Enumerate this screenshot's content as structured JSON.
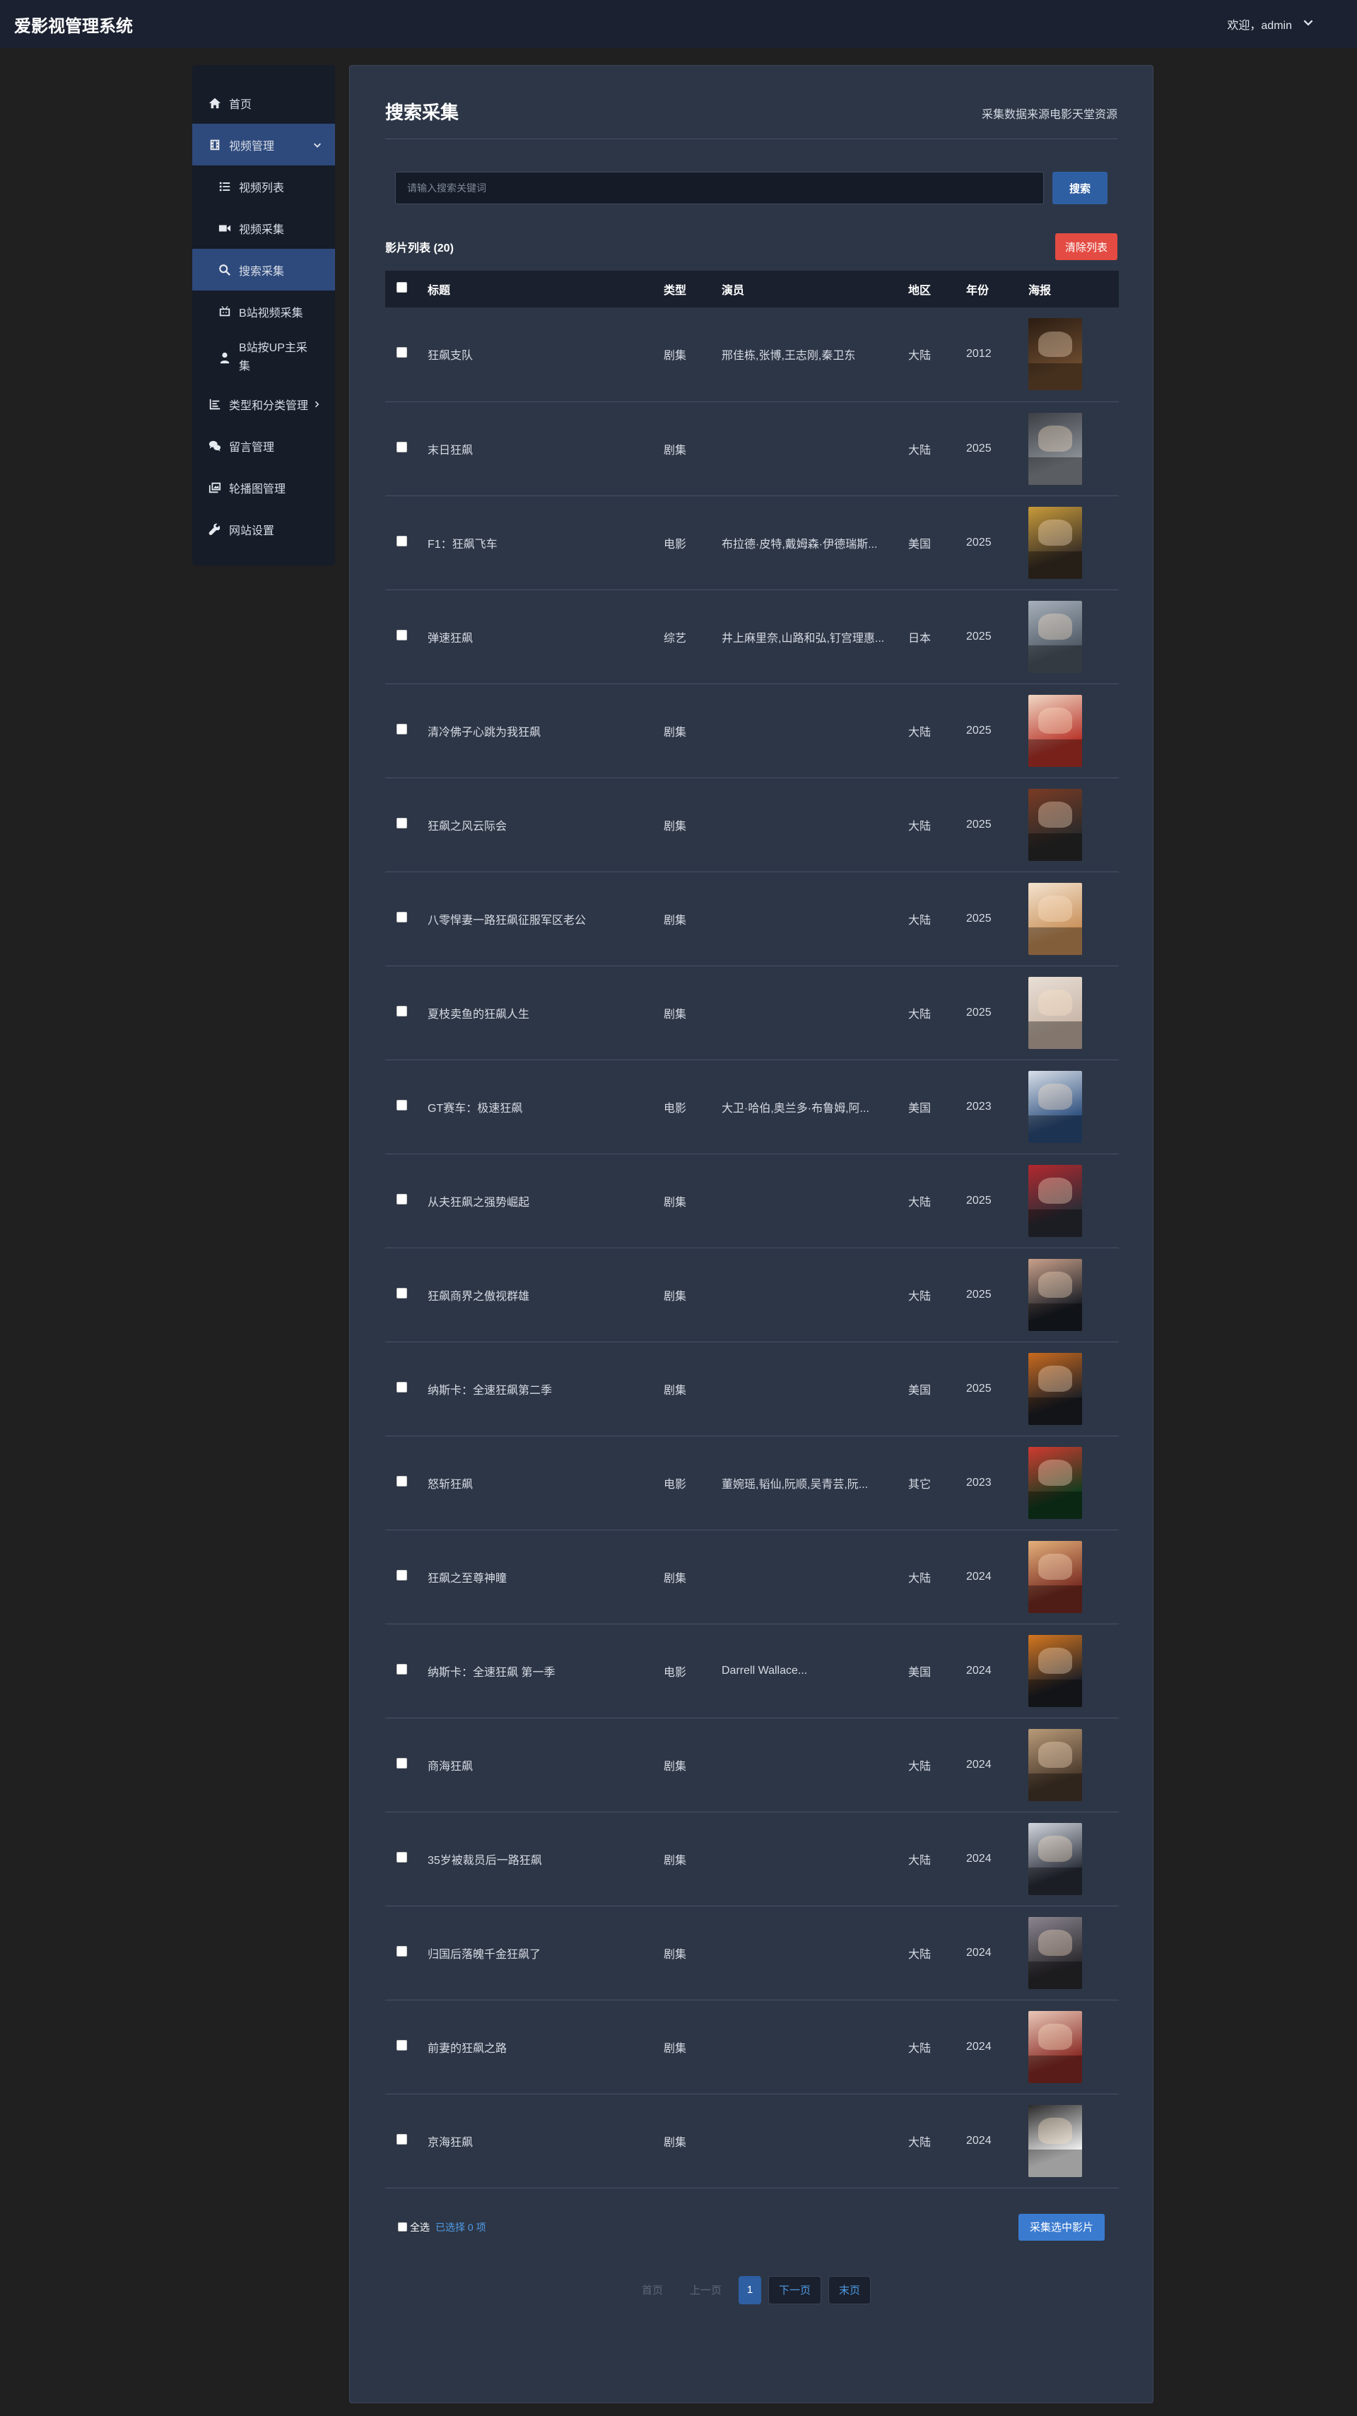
{
  "app": {
    "title": "爱影视管理系统",
    "welcome": "欢迎，admin"
  },
  "sidebar": {
    "items": [
      {
        "label": "首页",
        "icon": "home-icon"
      },
      {
        "label": "视频管理",
        "icon": "film-icon"
      },
      {
        "label": "视频列表",
        "icon": "list-icon"
      },
      {
        "label": "视频采集",
        "icon": "video-camera-icon"
      },
      {
        "label": "搜索采集",
        "icon": "search-icon"
      },
      {
        "label": "B站视频采集",
        "icon": "tv-icon"
      },
      {
        "label": "B站按UP主采集",
        "icon": "user-icon"
      },
      {
        "label": "类型和分类管理",
        "icon": "chart-icon"
      },
      {
        "label": "留言管理",
        "icon": "comments-icon"
      },
      {
        "label": "轮播图管理",
        "icon": "images-icon"
      },
      {
        "label": "网站设置",
        "icon": "wrench-icon"
      }
    ]
  },
  "main": {
    "title": "搜索采集",
    "source_note": "采集数据来源电影天堂资源",
    "search": {
      "placeholder": "请输入搜索关键词",
      "value": "",
      "button": "搜索"
    },
    "list_title": "影片列表 (20)",
    "clear_button": "清除列表",
    "columns": [
      "标题",
      "类型",
      "演员",
      "地区",
      "年份",
      "海报"
    ],
    "rows": [
      {
        "title": "狂飙支队",
        "type": "剧集",
        "actors": "邢佳栋,张博,王志刚,秦卫东",
        "area": "大陆",
        "year": "2012"
      },
      {
        "title": "末日狂飙",
        "type": "剧集",
        "actors": "",
        "area": "大陆",
        "year": "2025"
      },
      {
        "title": "F1：狂飙飞车",
        "type": "电影",
        "actors": "布拉德·皮特,戴姆森·伊德瑞斯...",
        "area": "美国",
        "year": "2025"
      },
      {
        "title": "弹速狂飙",
        "type": "综艺",
        "actors": "井上麻里奈,山路和弘,钉宫理惠...",
        "area": "日本",
        "year": "2025"
      },
      {
        "title": "清冷佛子心跳为我狂飙",
        "type": "剧集",
        "actors": "",
        "area": "大陆",
        "year": "2025"
      },
      {
        "title": "狂飙之风云际会",
        "type": "剧集",
        "actors": "",
        "area": "大陆",
        "year": "2025"
      },
      {
        "title": "八零悍妻一路狂飙征服军区老公",
        "type": "剧集",
        "actors": "",
        "area": "大陆",
        "year": "2025"
      },
      {
        "title": "夏枝卖鱼的狂飙人生",
        "type": "剧集",
        "actors": "",
        "area": "大陆",
        "year": "2025"
      },
      {
        "title": "GT赛车：极速狂飙",
        "type": "电影",
        "actors": "大卫·哈伯,奥兰多·布鲁姆,阿...",
        "area": "美国",
        "year": "2023"
      },
      {
        "title": "从夫狂飙之强势崛起",
        "type": "剧集",
        "actors": "",
        "area": "大陆",
        "year": "2025"
      },
      {
        "title": "狂飙商界之傲视群雄",
        "type": "剧集",
        "actors": "",
        "area": "大陆",
        "year": "2025"
      },
      {
        "title": "纳斯卡：全速狂飙第二季",
        "type": "剧集",
        "actors": "",
        "area": "美国",
        "year": "2025"
      },
      {
        "title": "怒斩狂飙",
        "type": "电影",
        "actors": "董婉瑶,韬仙,阮顺,吴青芸,阮...",
        "area": "其它",
        "year": "2023"
      },
      {
        "title": "狂飙之至尊神瞳",
        "type": "剧集",
        "actors": "",
        "area": "大陆",
        "year": "2024"
      },
      {
        "title": "纳斯卡：全速狂飙 第一季",
        "type": "电影",
        "actors": "Darrell Wallace...",
        "area": "美国",
        "year": "2024"
      },
      {
        "title": "商海狂飙",
        "type": "剧集",
        "actors": "",
        "area": "大陆",
        "year": "2024"
      },
      {
        "title": "35岁被裁员后一路狂飙",
        "type": "剧集",
        "actors": "",
        "area": "大陆",
        "year": "2024"
      },
      {
        "title": "归国后落魄千金狂飙了",
        "type": "剧集",
        "actors": "",
        "area": "大陆",
        "year": "2024"
      },
      {
        "title": "前妻的狂飙之路",
        "type": "剧集",
        "actors": "",
        "area": "大陆",
        "year": "2024"
      },
      {
        "title": "京海狂飙",
        "type": "剧集",
        "actors": "",
        "area": "大陆",
        "year": "2024"
      }
    ],
    "select_all": "全选",
    "selected_text": "已选择 0 项",
    "collect_button": "采集选中影片",
    "pagination": {
      "first": "首页",
      "prev": "上一页",
      "current": "1",
      "next": "下一页",
      "last": "末页"
    }
  },
  "colors": {
    "background": "#202020",
    "topbar": "#1b2130",
    "sidebar": "#161c28",
    "panel": "#2d3646",
    "accent": "#2e5fa3",
    "danger": "#e34b43",
    "link": "#4f9be6"
  },
  "posters": [
    [
      "#6b4a2e",
      "#2a1c12"
    ],
    [
      "#8a8f96",
      "#3c3f44"
    ],
    [
      "#3a3026",
      "#c79a3a"
    ],
    [
      "#4f5a66",
      "#a7b0ba"
    ],
    [
      "#b8342a",
      "#f0d7c4"
    ],
    [
      "#2a2a2a",
      "#7a3b24"
    ],
    [
      "#c9915a",
      "#f3e3cf"
    ],
    [
      "#c8b6a8",
      "#e9dfd6"
    ],
    [
      "#2d4f7e",
      "#d8dfe8"
    ],
    [
      "#2a2d36",
      "#b3282e"
    ],
    [
      "#1a1e26",
      "#c9a08a"
    ],
    [
      "#1d1f26",
      "#c86a1e"
    ],
    [
      "#0f3d1e",
      "#d03a30"
    ],
    [
      "#7a2c22",
      "#e3b07a"
    ],
    [
      "#1d1f26",
      "#d4761f"
    ],
    [
      "#4b3a2c",
      "#b89a78"
    ],
    [
      "#2a2f3a",
      "#d2d6de"
    ],
    [
      "#2c2a2e",
      "#8a8590"
    ],
    [
      "#8a2b25",
      "#e8c8b8"
    ],
    [
      "#f2f2f2",
      "#2a2a2a"
    ]
  ]
}
